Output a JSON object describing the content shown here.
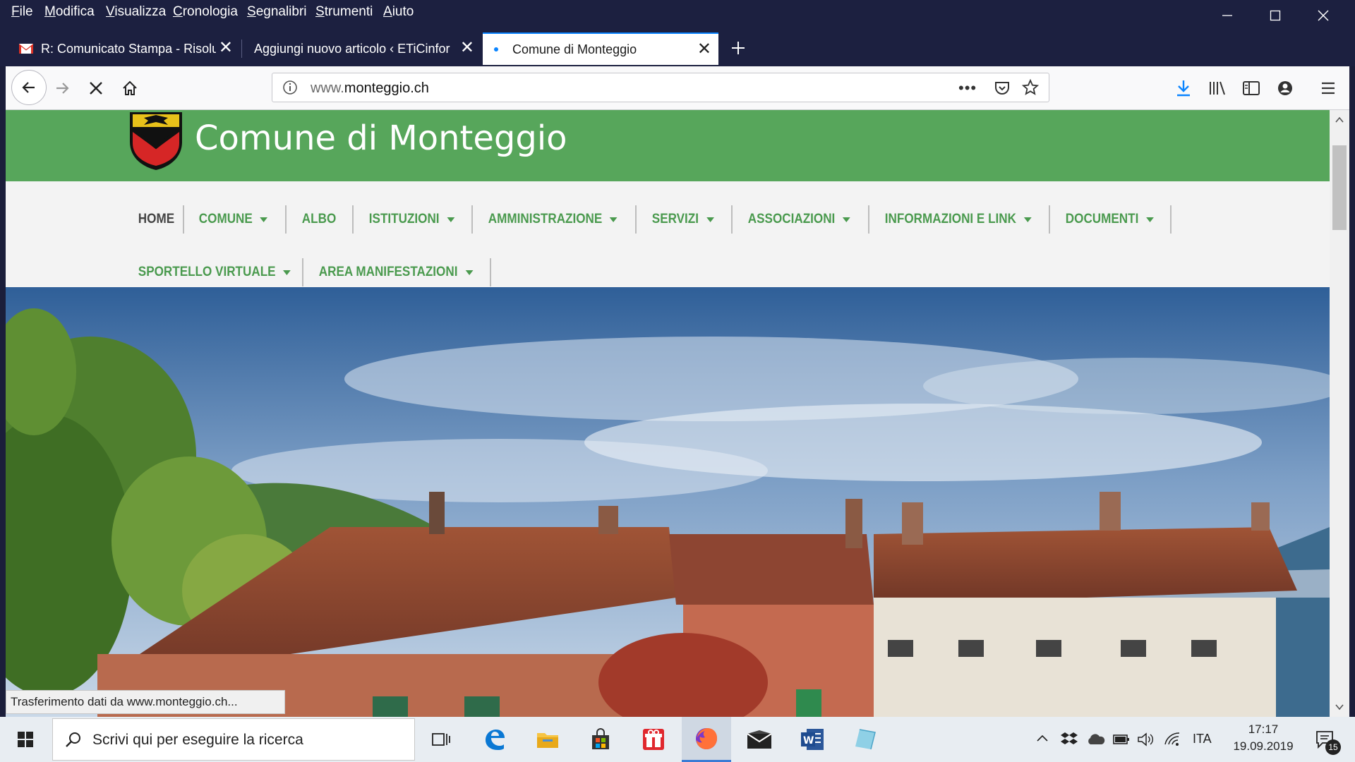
{
  "menubar": {
    "items": [
      {
        "accel": "F",
        "rest": "ile"
      },
      {
        "accel": "M",
        "rest": "odifica"
      },
      {
        "accel": "V",
        "rest": "isualizza"
      },
      {
        "accel": "C",
        "rest": "ronologia"
      },
      {
        "accel": "S",
        "rest": "egnalibri"
      },
      {
        "accel": "S",
        "rest": "trumenti"
      },
      {
        "accel": "A",
        "rest": "iuto"
      }
    ]
  },
  "tabs": [
    {
      "title": "R: Comunicato Stampa - Risoluz",
      "icon": "gmail-icon",
      "active": false
    },
    {
      "title": "Aggiungi nuovo articolo ‹ ETiCinfor",
      "icon": "none",
      "active": false
    },
    {
      "title": "Comune di Monteggio",
      "icon": "loading-dot-icon",
      "active": true
    }
  ],
  "url": {
    "prefix": "www.",
    "domain": "monteggio.ch"
  },
  "site": {
    "title": "Comune di Monteggio",
    "nav": [
      {
        "label": "HOME",
        "dropdown": false
      },
      {
        "label": "COMUNE",
        "dropdown": true
      },
      {
        "label": "ALBO",
        "dropdown": false
      },
      {
        "label": "ISTITUZIONI",
        "dropdown": true
      },
      {
        "label": "AMMINISTRAZIONE",
        "dropdown": true
      },
      {
        "label": "SERVIZI",
        "dropdown": true
      },
      {
        "label": "ASSOCIAZIONI",
        "dropdown": true
      },
      {
        "label": "INFORMAZIONI E LINK",
        "dropdown": true
      },
      {
        "label": "DOCUMENTI",
        "dropdown": true
      },
      {
        "label": "SPORTELLO VIRTUALE",
        "dropdown": true
      },
      {
        "label": "AREA MANIFESTAZIONI",
        "dropdown": true
      }
    ],
    "colors": {
      "header": "#57a65b",
      "nav_text": "#4a9a4e"
    }
  },
  "status_text": "Trasferimento dati da www.monteggio.ch...",
  "taskbar": {
    "search_placeholder": "Scrivi qui per eseguire la ricerca",
    "language": "ITA",
    "time": "17:17",
    "date": "19.09.2019",
    "notification_count": "15"
  }
}
